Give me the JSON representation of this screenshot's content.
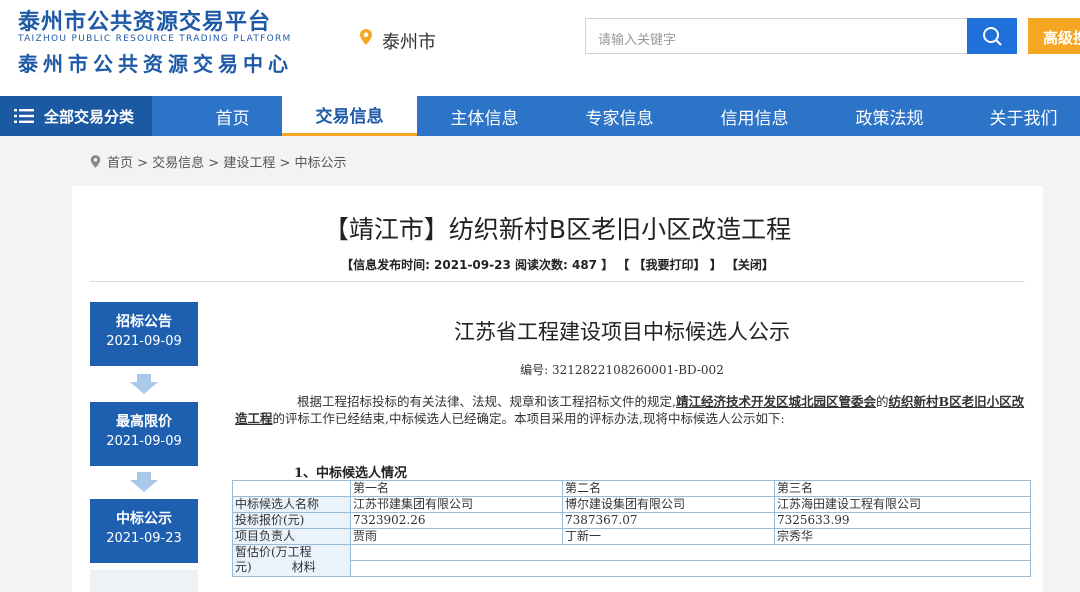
{
  "header": {
    "logo_title": "泰州市公共资源交易平台",
    "logo_subtitle_en": "TAIZHOU PUBLIC RESOURCE TRADING PLATFORM",
    "logo_subtitle_cn": "泰州市公共资源交易中心",
    "location": "泰州市",
    "search_placeholder": "请输入关键字",
    "advanced_label": "高级搜"
  },
  "nav": {
    "all_categories": "全部交易分类",
    "items": [
      "首页",
      "交易信息",
      "主体信息",
      "专家信息",
      "信用信息",
      "政策法规",
      "关于我们"
    ],
    "active_index": 1
  },
  "breadcrumb": "首页 > 交易信息 > 建设工程 > 中标公示",
  "article": {
    "title": "【靖江市】纺织新村B区老旧小区改造工程",
    "meta": "【信息发布时间:  2021-09-23   阅读次数:   487 】 【 【我要打印】 】 【关闭】"
  },
  "timeline": [
    {
      "label": "招标公告",
      "date": "2021-09-09"
    },
    {
      "label": "最高限价",
      "date": "2021-09-09"
    },
    {
      "label": "中标公示",
      "date": "2021-09-23"
    }
  ],
  "document": {
    "title": "江苏省工程建设项目中标候选人公示",
    "number": "编号: 3212822108260001-BD-002",
    "para_before": "根据工程招标投标的有关法律、法规、规章和该工程招标文件的规定,",
    "para_link1": "靖江经济技术开发区城北园区管委会",
    "para_mid": "的",
    "para_link2": "纺织新村B区老旧小区改造工程",
    "para_after": "的评标工作已经结束,中标候选人已经确定。本项目采用的评标办法,现将中标候选人公示如下:",
    "section_title": "1、中标候选人情况",
    "table": {
      "ranks": [
        "第一名",
        "第二名",
        "第三名"
      ],
      "rows": [
        {
          "label": "中标候选人名称",
          "values": [
            "江苏邗建集团有限公司",
            "博尔建设集团有限公司",
            "江苏海田建设工程有限公司"
          ]
        },
        {
          "label": "投标报价(元)",
          "values": [
            "7323902.26",
            "7387367.07",
            "7325633.99"
          ]
        },
        {
          "label": "项目负责人",
          "values": [
            "贾雨",
            "丁新一",
            "宗秀华"
          ]
        }
      ],
      "estimate_label_1": "暂估价(万工程",
      "estimate_label_2": "元)",
      "estimate_label_3": "材料"
    }
  }
}
